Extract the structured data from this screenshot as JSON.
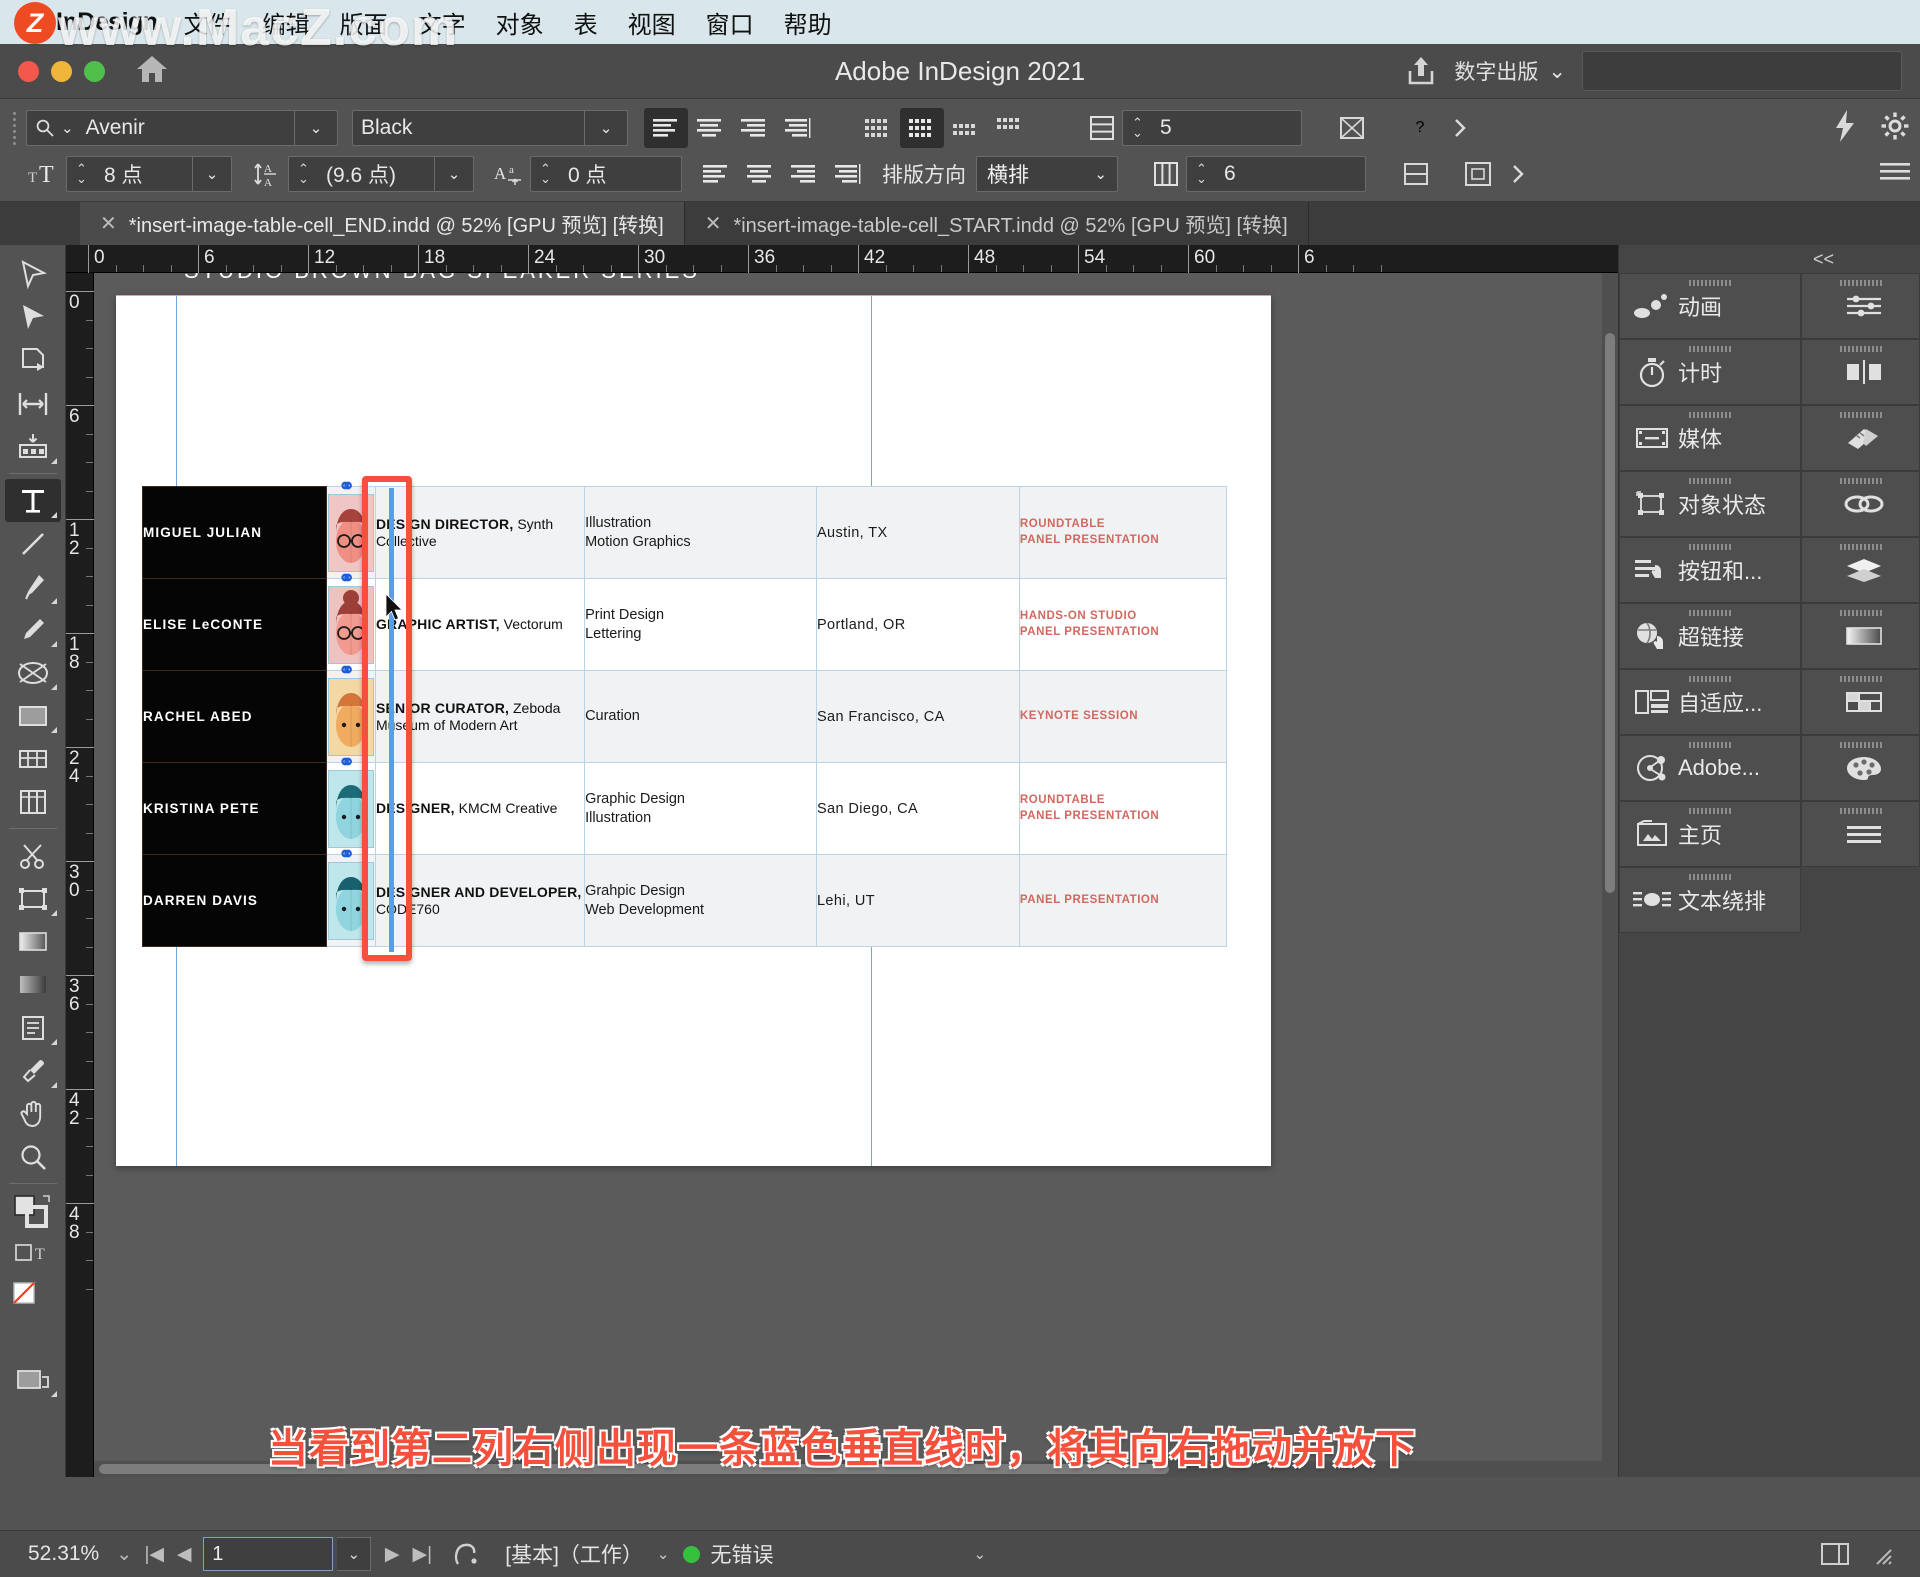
{
  "menubar": {
    "app_name": "InDesign",
    "watermark": "www.MacZ.com",
    "logo_letter": "Z",
    "items": [
      "文件",
      "编辑",
      "版面",
      "文字",
      "对象",
      "表",
      "视图",
      "窗口",
      "帮助"
    ]
  },
  "titlebar": {
    "title": "Adobe InDesign 2021",
    "workspace": "数字出版",
    "search_placeholder": ""
  },
  "control_bar": {
    "font_family": "Avenir",
    "font_style": "Black",
    "font_size": "8 点",
    "leading": "(9.6 点)",
    "tracking": "0 点",
    "flow_label": "排版方向",
    "flow_value": "横排",
    "rows": "5",
    "cols": "6",
    "help_label": "?"
  },
  "tabs": [
    {
      "label": "*insert-image-table-cell_END.indd @ 52% [GPU 预览] [转换]",
      "active": true
    },
    {
      "label": "*insert-image-table-cell_START.indd @ 52% [GPU 预览] [转换]",
      "active": false
    }
  ],
  "rulers": {
    "horizontal": [
      "0",
      "6",
      "12",
      "18",
      "24",
      "30",
      "36",
      "42",
      "48",
      "54",
      "60",
      "6"
    ],
    "vertical": [
      "0",
      "6",
      "12",
      "18",
      "24",
      "30",
      "36",
      "42",
      "48"
    ]
  },
  "document": {
    "page_header": "STUDIO BROWN BAG SPEAKER SERIES",
    "columns": [
      "name",
      "photo",
      "role",
      "skills",
      "city",
      "session"
    ],
    "rows": [
      {
        "name": "MIGUEL JULIAN",
        "role_title": "DESIGN DIRECTOR,",
        "role_org": "Synth Collective",
        "skills": [
          "Illustration",
          "Motion Graphics"
        ],
        "city": "Austin, TX",
        "session": [
          "ROUNDTABLE",
          "PANEL PRESENTATION"
        ],
        "avatar_tone": "pink"
      },
      {
        "name": "ELISE LeCONTE",
        "role_title": "GRAPHIC ARTIST,",
        "role_org": "Vectorum",
        "skills": [
          "Print Design",
          "Lettering"
        ],
        "city": "Portland, OR",
        "session": [
          "HANDS-ON STUDIO",
          "PANEL PRESENTATION"
        ],
        "avatar_tone": "pink2"
      },
      {
        "name": "RACHEL ABED",
        "role_title": "SENIOR CURATOR,",
        "role_org": "Zeboda Museum of Modern Art",
        "skills": [
          "Curation"
        ],
        "city": "San Francisco, CA",
        "session": [
          "KEYNOTE SESSION"
        ],
        "avatar_tone": "orange"
      },
      {
        "name": "KRISTINA PETE",
        "role_title": "DESIGNER,",
        "role_org": "KMCM Creative",
        "skills": [
          "Graphic Design",
          "Illustration"
        ],
        "city": "San Diego, CA",
        "session": [
          "ROUNDTABLE",
          "PANEL PRESENTATION"
        ],
        "avatar_tone": "teal"
      },
      {
        "name": "DARREN DAVIS",
        "role_title": "DESIGNER AND DEVELOPER,",
        "role_org": "CODE760",
        "skills": [
          "Grahpic Design",
          "Web Development"
        ],
        "city": "Lehi, UT",
        "session": [
          "PANEL PRESENTATION"
        ],
        "avatar_tone": "teal2"
      }
    ]
  },
  "annotation": {
    "caption": "当看到第二列右侧出现一条蓝色垂直线时，将其向右拖动并放下",
    "highlight_color": "#f6503c",
    "guide_color": "#5d9cec"
  },
  "right_panels": {
    "collapse_label": "<<",
    "wide_items": [
      {
        "label": "动画",
        "icon": "animation-icon"
      },
      {
        "label": "计时",
        "icon": "timing-icon"
      },
      {
        "label": "媒体",
        "icon": "media-icon"
      },
      {
        "label": "对象状态",
        "icon": "object-states-icon"
      },
      {
        "label": "按钮和...",
        "icon": "buttons-forms-icon"
      },
      {
        "label": "超链接",
        "icon": "hyperlinks-icon"
      },
      {
        "label": "自适应...",
        "icon": "liquid-layout-icon"
      },
      {
        "label": "Adobe...",
        "icon": "adobe-stock-icon"
      },
      {
        "label": "主页",
        "icon": "pages-master-icon"
      },
      {
        "label": "文本绕排",
        "icon": "text-wrap-icon"
      }
    ],
    "narrow_items": [
      {
        "icon": "properties-icon"
      },
      {
        "icon": "align-icon"
      },
      {
        "icon": "pathfinder-icon"
      },
      {
        "icon": "links-icon"
      },
      {
        "icon": "layers-icon"
      },
      {
        "icon": "gradient-icon"
      },
      {
        "icon": "table-icon"
      },
      {
        "icon": "swatches-icon"
      },
      {
        "icon": "paragraph-styles-icon"
      }
    ]
  },
  "statusbar": {
    "zoom": "52.31%",
    "page": "1",
    "workspace": "[基本]（工作）",
    "errors": "无错误",
    "error_dot_color": "#35c13c"
  },
  "toolbar": {
    "tools": [
      "selection-arrow-tool",
      "direct-selection-tool",
      "page-tool",
      "gap-tool",
      "content-collector-tool",
      "type-tool",
      "line-tool",
      "pen-tool",
      "pencil-tool",
      "frame-ellipse-tool",
      "rectangle-tool",
      "table-frame-tool",
      "column-tool",
      "scissors-tool",
      "free-transform-tool",
      "gradient-swatch-tool",
      "gradient-feather-tool",
      "note-tool",
      "eyedropper-tool",
      "hand-tool",
      "zoom-tool"
    ]
  }
}
